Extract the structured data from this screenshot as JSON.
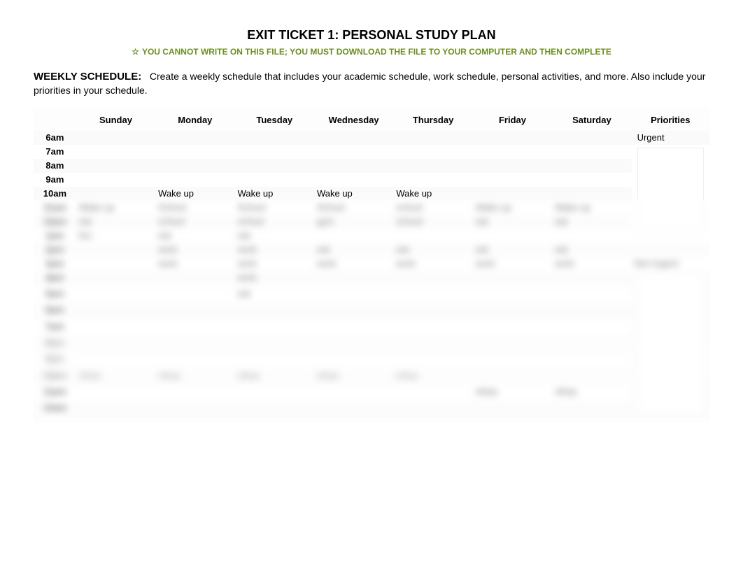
{
  "title": "EXIT TICKET 1: PERSONAL STUDY PLAN",
  "subtitle": "YOU CANNOT WRITE ON THIS FILE; YOU MUST DOWNLOAD THE FILE TO YOUR COMPUTER AND THEN COMPLETE",
  "section_label": "WEEKLY SCHEDULE:",
  "section_text": "Create a weekly schedule that includes your academic schedule, work schedule, personal activities, and more. Also include your priorities in your schedule.",
  "headers": [
    "",
    "Sunday",
    "Monday",
    "Tuesday",
    "Wednesday",
    "Thursday",
    "Friday",
    "Saturday",
    "Priorities"
  ],
  "times": [
    "6am",
    "7am",
    "8am",
    "9am",
    "10am",
    "11am",
    "12pm",
    "1pm",
    "2pm",
    "3pm",
    "4pm",
    "5pm",
    "6pm",
    "7pm",
    "8pm",
    "9pm",
    "10pm",
    "11pm",
    "12am"
  ],
  "rows": {
    "6am": [
      "",
      "",
      "",
      "",
      "",
      "",
      "",
      ""
    ],
    "7am": [
      "",
      "",
      "",
      "",
      "",
      "",
      "",
      ""
    ],
    "8am": [
      "",
      "",
      "",
      "",
      "",
      "",
      "",
      ""
    ],
    "9am": [
      "",
      "",
      "",
      "",
      "",
      "",
      "",
      ""
    ],
    "10am": [
      "",
      "Wake up",
      "Wake up",
      "Wake up",
      "Wake up",
      "",
      "",
      ""
    ],
    "11am": [
      "Wake up",
      "School",
      "School",
      "School",
      "school",
      "Wake up",
      "Wake up",
      ""
    ],
    "12pm": [
      "eat",
      "school",
      "school",
      "gym",
      "school",
      "eat",
      "eat",
      ""
    ],
    "1pm": [
      "fun",
      "eat",
      "eat",
      "",
      "",
      "",
      "",
      ""
    ],
    "2pm": [
      "",
      "work",
      "work",
      "eat",
      "eat",
      "eat",
      "eat",
      ""
    ],
    "3pm": [
      "",
      "work",
      "work",
      "work",
      "work",
      "work",
      "work",
      ""
    ],
    "4pm": [
      "",
      "",
      "work",
      "",
      "",
      "",
      "",
      ""
    ],
    "5pm": [
      "",
      "",
      "eat",
      "",
      "",
      "",
      "",
      ""
    ],
    "6pm": [
      "",
      "",
      "",
      "",
      "",
      "",
      "",
      ""
    ],
    "7pm": [
      "",
      "",
      "",
      "",
      "",
      "",
      "",
      ""
    ],
    "8pm": [
      "",
      "",
      "",
      "",
      "",
      "",
      "",
      ""
    ],
    "9pm": [
      "",
      "",
      "",
      "",
      "",
      "",
      "",
      ""
    ],
    "10pm": [
      "sleep",
      "sleep",
      "sleep",
      "sleep",
      "sleep",
      "",
      "",
      ""
    ],
    "11pm": [
      "",
      "",
      "",
      "",
      "",
      "sleep",
      "sleep",
      ""
    ],
    "12am": [
      "",
      "",
      "",
      "",
      "",
      "",
      "",
      ""
    ]
  },
  "priorities": {
    "urgent_label": "Urgent",
    "not_urgent_label": "Not Urgent"
  }
}
